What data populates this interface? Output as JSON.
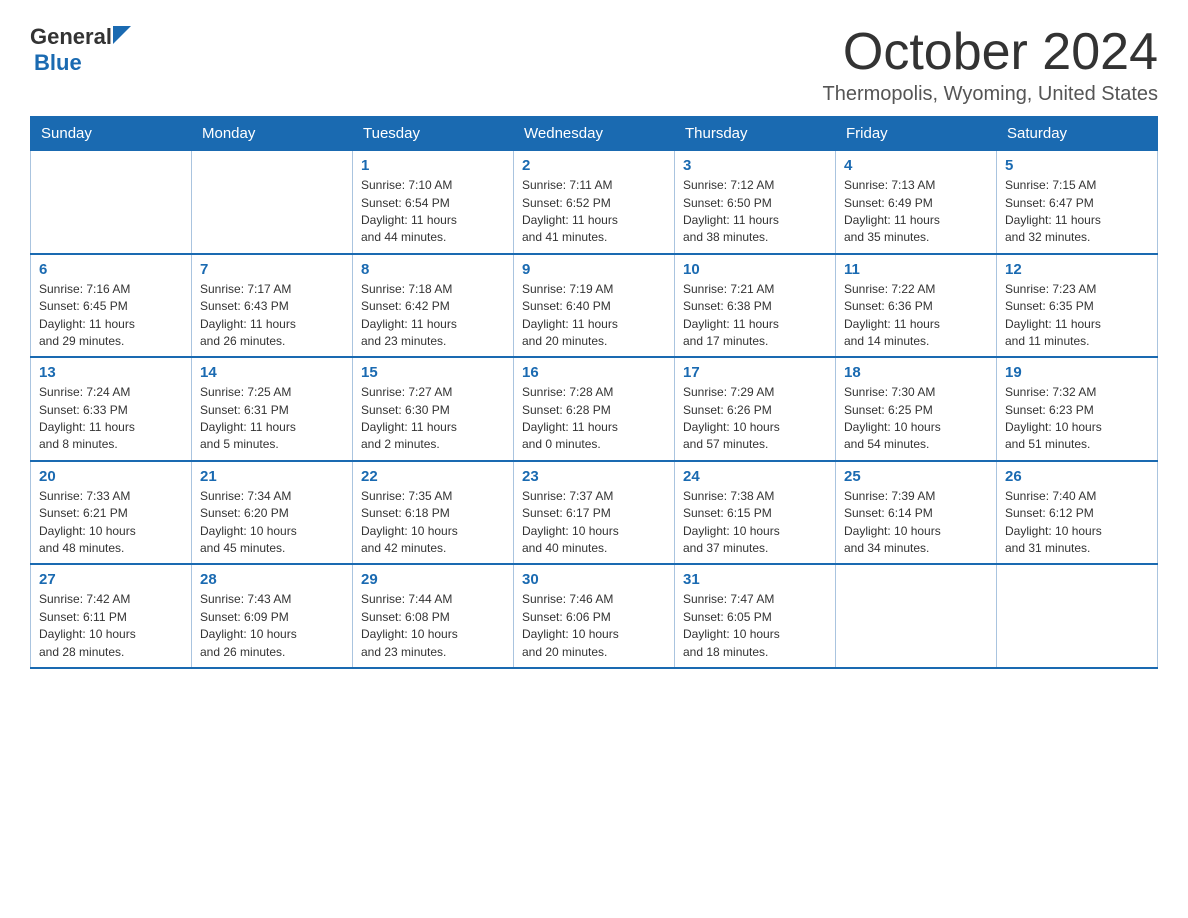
{
  "header": {
    "logo_general": "General",
    "logo_blue": "Blue",
    "month_year": "October 2024",
    "location": "Thermopolis, Wyoming, United States"
  },
  "days_of_week": [
    "Sunday",
    "Monday",
    "Tuesday",
    "Wednesday",
    "Thursday",
    "Friday",
    "Saturday"
  ],
  "weeks": [
    [
      {
        "day": "",
        "info": ""
      },
      {
        "day": "",
        "info": ""
      },
      {
        "day": "1",
        "info": "Sunrise: 7:10 AM\nSunset: 6:54 PM\nDaylight: 11 hours\nand 44 minutes."
      },
      {
        "day": "2",
        "info": "Sunrise: 7:11 AM\nSunset: 6:52 PM\nDaylight: 11 hours\nand 41 minutes."
      },
      {
        "day": "3",
        "info": "Sunrise: 7:12 AM\nSunset: 6:50 PM\nDaylight: 11 hours\nand 38 minutes."
      },
      {
        "day": "4",
        "info": "Sunrise: 7:13 AM\nSunset: 6:49 PM\nDaylight: 11 hours\nand 35 minutes."
      },
      {
        "day": "5",
        "info": "Sunrise: 7:15 AM\nSunset: 6:47 PM\nDaylight: 11 hours\nand 32 minutes."
      }
    ],
    [
      {
        "day": "6",
        "info": "Sunrise: 7:16 AM\nSunset: 6:45 PM\nDaylight: 11 hours\nand 29 minutes."
      },
      {
        "day": "7",
        "info": "Sunrise: 7:17 AM\nSunset: 6:43 PM\nDaylight: 11 hours\nand 26 minutes."
      },
      {
        "day": "8",
        "info": "Sunrise: 7:18 AM\nSunset: 6:42 PM\nDaylight: 11 hours\nand 23 minutes."
      },
      {
        "day": "9",
        "info": "Sunrise: 7:19 AM\nSunset: 6:40 PM\nDaylight: 11 hours\nand 20 minutes."
      },
      {
        "day": "10",
        "info": "Sunrise: 7:21 AM\nSunset: 6:38 PM\nDaylight: 11 hours\nand 17 minutes."
      },
      {
        "day": "11",
        "info": "Sunrise: 7:22 AM\nSunset: 6:36 PM\nDaylight: 11 hours\nand 14 minutes."
      },
      {
        "day": "12",
        "info": "Sunrise: 7:23 AM\nSunset: 6:35 PM\nDaylight: 11 hours\nand 11 minutes."
      }
    ],
    [
      {
        "day": "13",
        "info": "Sunrise: 7:24 AM\nSunset: 6:33 PM\nDaylight: 11 hours\nand 8 minutes."
      },
      {
        "day": "14",
        "info": "Sunrise: 7:25 AM\nSunset: 6:31 PM\nDaylight: 11 hours\nand 5 minutes."
      },
      {
        "day": "15",
        "info": "Sunrise: 7:27 AM\nSunset: 6:30 PM\nDaylight: 11 hours\nand 2 minutes."
      },
      {
        "day": "16",
        "info": "Sunrise: 7:28 AM\nSunset: 6:28 PM\nDaylight: 11 hours\nand 0 minutes."
      },
      {
        "day": "17",
        "info": "Sunrise: 7:29 AM\nSunset: 6:26 PM\nDaylight: 10 hours\nand 57 minutes."
      },
      {
        "day": "18",
        "info": "Sunrise: 7:30 AM\nSunset: 6:25 PM\nDaylight: 10 hours\nand 54 minutes."
      },
      {
        "day": "19",
        "info": "Sunrise: 7:32 AM\nSunset: 6:23 PM\nDaylight: 10 hours\nand 51 minutes."
      }
    ],
    [
      {
        "day": "20",
        "info": "Sunrise: 7:33 AM\nSunset: 6:21 PM\nDaylight: 10 hours\nand 48 minutes."
      },
      {
        "day": "21",
        "info": "Sunrise: 7:34 AM\nSunset: 6:20 PM\nDaylight: 10 hours\nand 45 minutes."
      },
      {
        "day": "22",
        "info": "Sunrise: 7:35 AM\nSunset: 6:18 PM\nDaylight: 10 hours\nand 42 minutes."
      },
      {
        "day": "23",
        "info": "Sunrise: 7:37 AM\nSunset: 6:17 PM\nDaylight: 10 hours\nand 40 minutes."
      },
      {
        "day": "24",
        "info": "Sunrise: 7:38 AM\nSunset: 6:15 PM\nDaylight: 10 hours\nand 37 minutes."
      },
      {
        "day": "25",
        "info": "Sunrise: 7:39 AM\nSunset: 6:14 PM\nDaylight: 10 hours\nand 34 minutes."
      },
      {
        "day": "26",
        "info": "Sunrise: 7:40 AM\nSunset: 6:12 PM\nDaylight: 10 hours\nand 31 minutes."
      }
    ],
    [
      {
        "day": "27",
        "info": "Sunrise: 7:42 AM\nSunset: 6:11 PM\nDaylight: 10 hours\nand 28 minutes."
      },
      {
        "day": "28",
        "info": "Sunrise: 7:43 AM\nSunset: 6:09 PM\nDaylight: 10 hours\nand 26 minutes."
      },
      {
        "day": "29",
        "info": "Sunrise: 7:44 AM\nSunset: 6:08 PM\nDaylight: 10 hours\nand 23 minutes."
      },
      {
        "day": "30",
        "info": "Sunrise: 7:46 AM\nSunset: 6:06 PM\nDaylight: 10 hours\nand 20 minutes."
      },
      {
        "day": "31",
        "info": "Sunrise: 7:47 AM\nSunset: 6:05 PM\nDaylight: 10 hours\nand 18 minutes."
      },
      {
        "day": "",
        "info": ""
      },
      {
        "day": "",
        "info": ""
      }
    ]
  ]
}
